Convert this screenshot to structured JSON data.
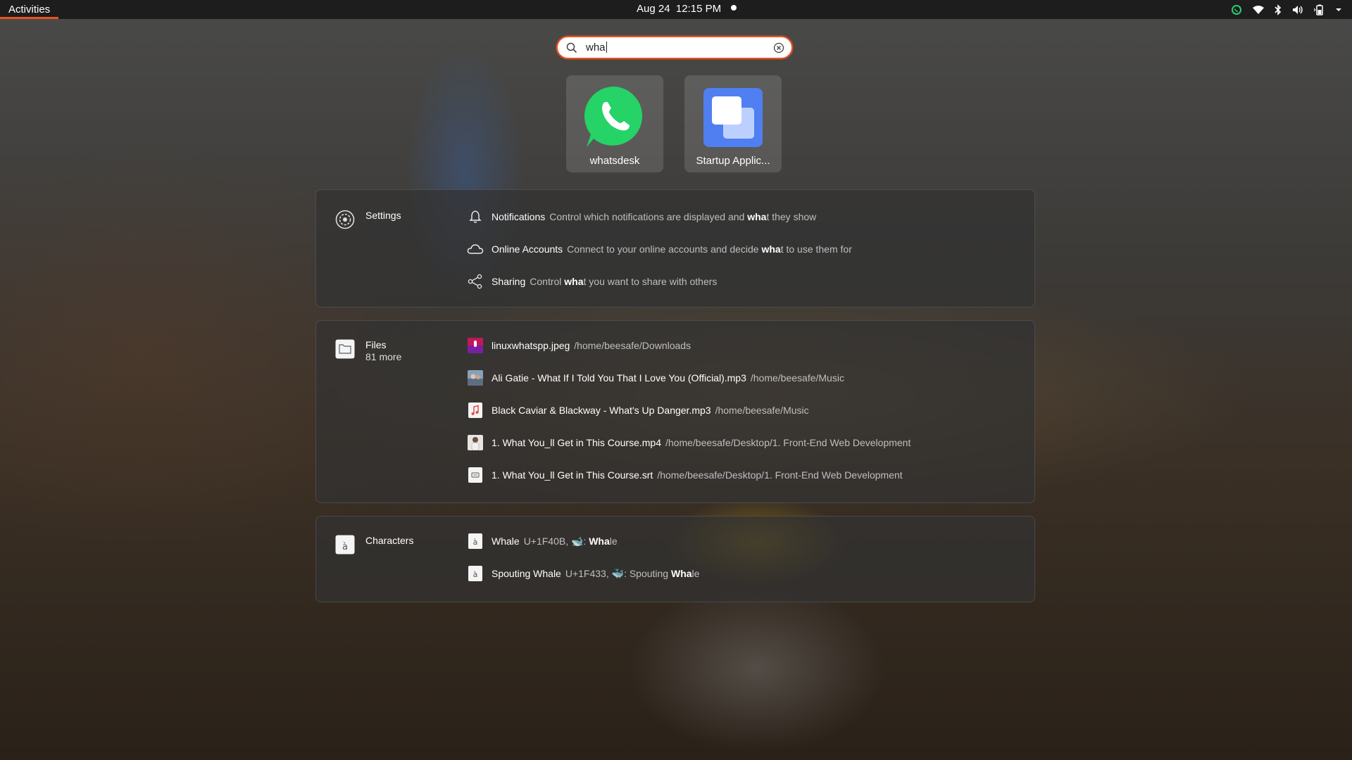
{
  "topbar": {
    "activities": "Activities",
    "datetime": "Aug 24  12:15 PM"
  },
  "search": {
    "value": "wha"
  },
  "apps": [
    {
      "label": "whatsdesk",
      "icon": "whatsapp-icon"
    },
    {
      "label": "Startup Applic...",
      "icon": "startup-applications-icon"
    }
  ],
  "settings": {
    "provider": "Settings",
    "rows": [
      {
        "title": "Notifications",
        "pre": "Control which notifications are displayed and ",
        "match": "wha",
        "post": "t they show",
        "icon": "bell-icon"
      },
      {
        "title": "Online Accounts",
        "pre": "Connect to your online accounts and decide ",
        "match": "wha",
        "post": "t to use them for",
        "icon": "cloud-icon"
      },
      {
        "title": "Sharing",
        "pre": "Control ",
        "match": "wha",
        "post": "t you want to share with others",
        "icon": "share-icon"
      }
    ]
  },
  "files": {
    "provider": "Files",
    "more": "81 more",
    "rows": [
      {
        "title": "linuxwhatspp.jpeg",
        "path": "/home/beesafe/Downloads",
        "icon": "image-thumbnail-icon"
      },
      {
        "title": "Ali Gatie - What If I Told You That I Love You (Official).mp3",
        "path": "/home/beesafe/Music",
        "icon": "audio-thumbnail-icon"
      },
      {
        "title": "Black Caviar & Blackway - What's Up Danger.mp3",
        "path": "/home/beesafe/Music",
        "icon": "audio-file-icon"
      },
      {
        "title": "1. What You_ll Get in This Course.mp4",
        "path": "/home/beesafe/Desktop/1. Front-End Web Development",
        "icon": "video-thumbnail-icon"
      },
      {
        "title": "1. What You_ll Get in This Course.srt",
        "path": "/home/beesafe/Desktop/1. Front-End Web Development",
        "icon": "subtitle-file-icon"
      }
    ]
  },
  "characters": {
    "provider": "Characters",
    "rows": [
      {
        "title": "Whale",
        "pre": "U+1F40B, 🐋: ",
        "match": "Wha",
        "post": "le",
        "icon": "character-icon"
      },
      {
        "title": "Spouting Whale",
        "pre": "U+1F433, 🐳: Spouting ",
        "match": "Wha",
        "post": "le",
        "icon": "character-icon"
      }
    ]
  },
  "colors": {
    "accent": "#e95420",
    "topbar": "#1d1d1d",
    "whatsapp": "#25d366",
    "startup": "#4f7ff0"
  }
}
